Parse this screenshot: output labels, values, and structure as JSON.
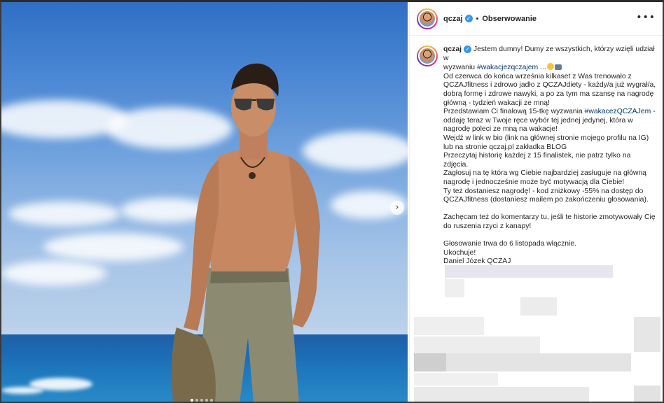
{
  "post": {
    "username": "qczaj",
    "separator": "•",
    "follow_label": "Obserwowanie",
    "more_label": "•••",
    "next_label": "›",
    "caption": {
      "line1_text": "Jestem dumny! Dumy ze wszystkich, którzy wzięli udział w",
      "line2_pre": "wyzwaniu ",
      "line2_tag": "#wakacjezqczajem",
      "line2_post": " ...",
      "body1": "Od czerwca do końca września kilkaset z Was trenowało z\nQCZAJfitness i zdrowo jadło z QCZAJdiety - każdy/a już wygrał/a,\ndobrą formę i zdrowe nawyki, a po za tym ma szansę na nagrodę\ngłówną - tydzień wakacji ze mną!\nPrzedstawiam Ci finałową 15-tkę wyzwania ",
      "body1_tag": "#wakacezQCZAJem",
      "body2": " -\noddaję teraz w Twoje ręce wybór tej jednej jedynej, która w\nnagrodę poleci ze mną na wakacje!\nWejdź w link w bio (link na głównej stronie mojego profilu na IG)\nlub na stronie qczaj.pl zakładka BLOG\nPrzeczytaj historię każdej z 15 finalistek, nie patrz tylko na zdjęcia.\nZagłosuj na tę która wg Ciebie najbardziej zasługuje na główną\nnagrodę i jednocześnie może być motywacją dla Ciebie!\nTy też dostaniesz nagrodę! - kod zniżkowy -55% na dostęp do\nQCZAJfitness (dostaniesz mailem po zakończeniu głosowania).\n\nZachęcam też do komentarzy tu, jeśli te historie zmotywowały Cię\ndo ruszenia rzyci z kanapy!\n\nGłosowanie trwa do 6 listopada włącznie.\nUkochuje!\nDaniel Józek QCZAJ"
    }
  },
  "colors": {
    "link": "#00376b",
    "verified": "#3897f0",
    "text": "#262626"
  },
  "icons": {
    "verified": "verified-badge-icon",
    "next": "chevron-right-icon",
    "more": "more-options-icon"
  }
}
